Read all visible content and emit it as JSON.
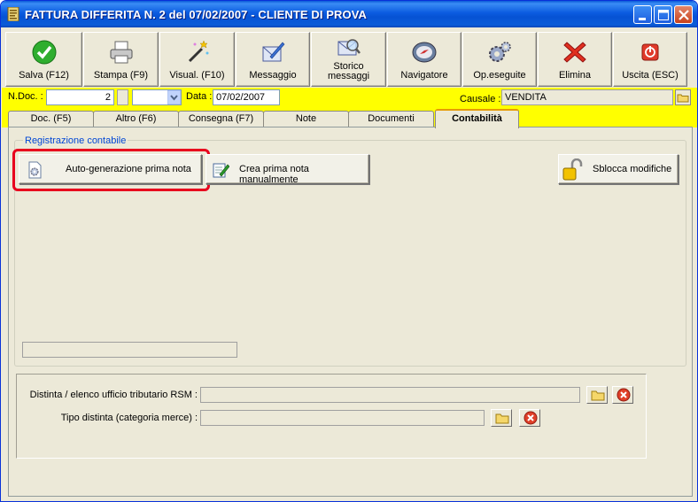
{
  "window": {
    "title": "FATTURA DIFFERITA N. 2  del 07/02/2007 - CLIENTE DI PROVA",
    "controls": [
      "minimize-icon",
      "maximize-icon",
      "close-icon"
    ]
  },
  "toolbar": {
    "buttons": [
      {
        "label": "Salva (F12)",
        "icon": "checkmark-icon"
      },
      {
        "label": "Stampa (F9)",
        "icon": "printer-icon"
      },
      {
        "label": "Visual. (F10)",
        "icon": "magic-wand-icon"
      },
      {
        "label": "Messaggio",
        "icon": "message-pen-icon"
      },
      {
        "label": "Storico\nmessaggi",
        "icon": "search-message-icon"
      },
      {
        "label": "Navigatore",
        "icon": "compass-icon"
      },
      {
        "label": "Op.eseguite",
        "icon": "gears-icon"
      },
      {
        "label": "Elimina",
        "icon": "delete-x-icon"
      },
      {
        "label": "Uscita (ESC)",
        "icon": "power-icon"
      }
    ]
  },
  "header": {
    "ndoc_label": "N.Doc. :",
    "ndoc_value": "2",
    "data_label": "Data :",
    "data_value": "07/02/2007",
    "causale_label": "Causale :",
    "causale_value": "VENDITA"
  },
  "tabs": [
    {
      "label": "Doc. (F5)",
      "active": false
    },
    {
      "label": "Altro (F6)",
      "active": false
    },
    {
      "label": "Consegna (F7)",
      "active": false
    },
    {
      "label": "Note",
      "active": false
    },
    {
      "label": "Documenti",
      "active": false
    },
    {
      "label": "Contabilità",
      "active": true
    }
  ],
  "registrazione": {
    "group_title": "Registrazione contabile",
    "auto_button": "Auto-generazione prima nota",
    "manual_button": "Crea prima nota manualmente",
    "unlock_button": "Sblocca modifiche"
  },
  "bottom": {
    "distinta_label": "Distinta / elenco ufficio tributario RSM :",
    "distinta_value": "",
    "tipo_label": "Tipo distinta (categoria merce) :",
    "tipo_value": ""
  },
  "colors": {
    "accent_yellow": "#ffff00",
    "highlight_red": "#e8001d",
    "titlebar_blue": "#0a5bd8"
  }
}
